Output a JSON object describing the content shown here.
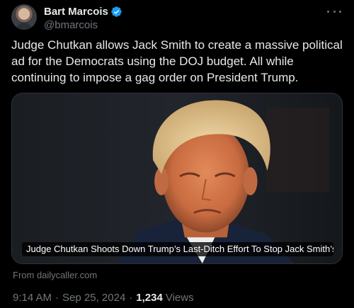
{
  "author": {
    "display_name": "Bart Marcois",
    "handle": "@bmarcois",
    "verified": true
  },
  "tweet": {
    "text": "Judge Chutkan allows Jack Smith to create a massive political ad for the Democrats using the DOJ budget. All while continuing to impose a gag order on President Trump."
  },
  "card": {
    "title": "Judge Chutkan Shoots Down Trump’s Last-Ditch Effort To Stop Jack Smith’s M...",
    "source": "From dailycaller.com"
  },
  "meta": {
    "time": "9:14 AM",
    "date": "Sep 25, 2024",
    "separator": "·",
    "views_count": "1,234",
    "views_label": "Views"
  },
  "icons": {
    "verified": "verified-badge-icon",
    "more": "more-options-icon"
  },
  "colors": {
    "background": "#000000",
    "text": "#e7e9ea",
    "secondary": "#71767b",
    "verified": "#1d9bf0",
    "border": "#2f3336"
  }
}
